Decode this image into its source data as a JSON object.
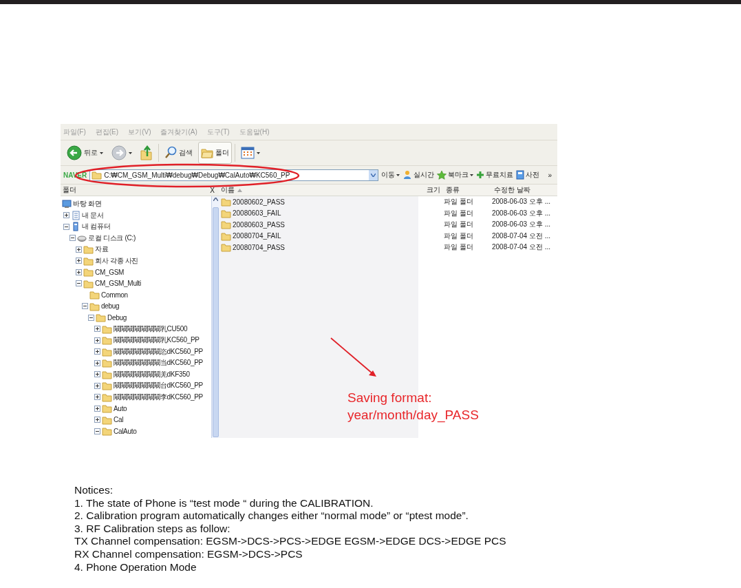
{
  "explorer": {
    "menu": [
      "파일(F)",
      "편집(E)",
      "보기(V)",
      "즐겨찾기(A)",
      "도구(T)",
      "도움말(H)"
    ],
    "toolbar": [
      {
        "kind": "back",
        "label": "뒤로",
        "dropdown": true,
        "selected": false
      },
      {
        "kind": "forward",
        "dropdown": true,
        "selected": false
      },
      {
        "kind": "up",
        "selected": false
      },
      {
        "kind": "search",
        "label": "검색",
        "selected": false
      },
      {
        "kind": "folders",
        "label": "폴더",
        "selected": true
      },
      {
        "kind": "views",
        "dropdown": true,
        "selected": false
      }
    ],
    "address": {
      "logo": "NAVER",
      "path": "C:₩CM_GSM_Multi₩debug₩Debug₩CalAuto₩KC560_PP",
      "go": "이동"
    },
    "links": [
      {
        "kind": "realtime",
        "label": "실시간"
      },
      {
        "kind": "bookmark",
        "label": "북마크",
        "dropdown": true
      },
      {
        "kind": "cure",
        "label": "무료치료"
      },
      {
        "kind": "dictionary",
        "label": "사전"
      }
    ],
    "more": "»",
    "folder_pane": {
      "title": "폴더",
      "close": "X"
    },
    "tree": [
      {
        "label": "바탕 화면",
        "kind": "desktop",
        "children": [
          {
            "label": "내 문서",
            "kind": "documents",
            "expanded": false
          },
          {
            "label": "내 컴퓨터",
            "kind": "computer",
            "expanded": true,
            "children": [
              {
                "label": "로컬 디스크 (C:)",
                "kind": "drive",
                "expanded": true,
                "children": [
                  {
                    "label": "자료",
                    "kind": "folder",
                    "expanded": false
                  },
                  {
                    "label": "회사 각종 사진",
                    "kind": "folder",
                    "expanded": false
                  },
                  {
                    "label": "CM_GSM",
                    "kind": "folder",
                    "expanded": false
                  },
                  {
                    "label": "CM_GSM_Multi",
                    "kind": "folder",
                    "expanded": true,
                    "children": [
                      {
                        "label": "Common",
                        "kind": "folder"
                      },
                      {
                        "label": "debug",
                        "kind": "folder",
                        "expanded": true,
                        "children": [
                          {
                            "label": "Debug",
                            "kind": "folder",
                            "expanded": true,
                            "children": [
                              {
                                "label": "鬫鬫鬫鬫鬫鬫鬫乳CU500",
                                "kind": "folder",
                                "expanded": false
                              },
                              {
                                "label": "鬫鬫鬫鬫鬫鬫鬫乳KC560_PP",
                                "kind": "folder",
                                "expanded": false
                              },
                              {
                                "label": "鬫鬫鬫鬫鬫鬫鬫恣dKC560_PP",
                                "kind": "folder",
                                "expanded": false
                              },
                              {
                                "label": "鬫鬫鬫鬫鬫鬫鬫当dKC560_PP",
                                "kind": "folder",
                                "expanded": false
                              },
                              {
                                "label": "鬫鬫鬫鬫鬫鬫鬫羌dKF350",
                                "kind": "folder",
                                "expanded": false
                              },
                              {
                                "label": "鬫鬫鬫鬫鬫鬫鬫台dKC560_PP",
                                "kind": "folder",
                                "expanded": false
                              },
                              {
                                "label": "鬫鬫鬫鬫鬫鬫鬫李dKC560_PP",
                                "kind": "folder",
                                "expanded": false
                              },
                              {
                                "label": "Auto",
                                "kind": "folder",
                                "expanded": false
                              },
                              {
                                "label": "Cal",
                                "kind": "folder",
                                "expanded": false
                              },
                              {
                                "label": "CalAuto",
                                "kind": "folder",
                                "expanded": true
                              }
                            ]
                          }
                        ]
                      }
                    ]
                  }
                ]
              }
            ]
          }
        ]
      }
    ],
    "columns": [
      {
        "label": "이름",
        "sorted": true
      },
      {
        "label": "크기",
        "sorted": false
      },
      {
        "label": "종류",
        "sorted": false
      },
      {
        "label": "수정한 날짜",
        "sorted": false
      }
    ],
    "files": [
      {
        "name": "20080602_PASS",
        "type": "파일 폴더",
        "modified": "2008-06-03 오후 ..."
      },
      {
        "name": "20080603_FAIL",
        "type": "파일 폴더",
        "modified": "2008-06-03 오후 ..."
      },
      {
        "name": "20080603_PASS",
        "type": "파일 폴더",
        "modified": "2008-06-03 오후 ..."
      },
      {
        "name": "20080704_FAIL",
        "type": "파일 폴더",
        "modified": "2008-07-04 오전 ..."
      },
      {
        "name": "20080704_PASS",
        "type": "파일 폴더",
        "modified": "2008-07-04 오전 ..."
      }
    ]
  },
  "annotation": {
    "lines": [
      "Saving format:",
      "year/month/day_PASS"
    ]
  },
  "notices": [
    "Notices:",
    "1. The state of Phone is “test mode “ during the CALIBRATION.",
    "2. Calibration program automatically changes either “normal mode” or “ptest mode”.",
    "3. RF Calibration steps as follow:",
    "TX Channel compensation: EGSM->DCS->PCS->EDGE EGSM->EDGE DCS->EDGE PCS",
    "RX Channel compensation: EGSM->DCS->PCS",
    "4. Phone Operation Mode"
  ]
}
